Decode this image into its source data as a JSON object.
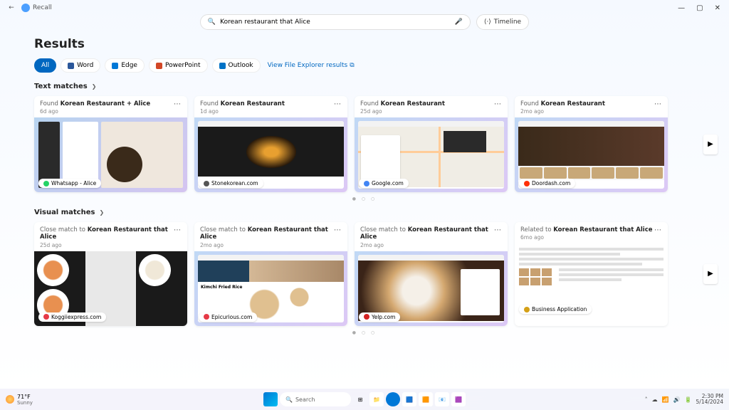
{
  "app": {
    "name": "Recall"
  },
  "search": {
    "value": "Korean restaurant that Alice",
    "timeline_label": "Timeline"
  },
  "page": {
    "title": "Results"
  },
  "filters": {
    "all": "All",
    "items": [
      {
        "label": "Word"
      },
      {
        "label": "Edge"
      },
      {
        "label": "PowerPoint"
      },
      {
        "label": "Outlook"
      }
    ],
    "explorer_link": "View File Explorer results"
  },
  "sections": {
    "text": {
      "title": "Text matches"
    },
    "visual": {
      "title": "Visual matches"
    }
  },
  "text_cards": [
    {
      "prefix": "Found ",
      "title": "Korean Restaurant + Alice",
      "time": "6d ago",
      "source": "Whatsapp - Alice",
      "color": "#25d366"
    },
    {
      "prefix": "Found ",
      "title": "Korean Restaurant",
      "time": "1d ago",
      "source": "Stonekorean.com",
      "color": "#555"
    },
    {
      "prefix": "Found ",
      "title": "Korean Restaurant",
      "time": "25d ago",
      "source": "Google.com",
      "color": "#4285f4"
    },
    {
      "prefix": "Found ",
      "title": "Korean Restaurant",
      "time": "2mo ago",
      "source": "Doordash.com",
      "color": "#ff3008"
    }
  ],
  "visual_cards": [
    {
      "prefix": "Close match to ",
      "title": "Korean Restaurant that Alice",
      "time": "25d ago",
      "source": "Koggiiexpress.com",
      "color": "#e63946"
    },
    {
      "prefix": "Close match to ",
      "title": "Korean Restaurant that Alice",
      "time": "2mo ago",
      "source": "Epicurious.com",
      "color": "#e63946",
      "extra": "Kimchi Fried Rice"
    },
    {
      "prefix": "Close match to ",
      "title": "Korean Restaurant that Alice",
      "time": "2mo ago",
      "source": "Yelp.com",
      "color": "#d32323"
    },
    {
      "prefix": "Related to ",
      "title": "Korean Restaurant that Alice",
      "time": "6mo ago",
      "source": "Business Application",
      "color": "#d4a017"
    }
  ],
  "taskbar": {
    "temp": "71°F",
    "cond": "Sunny",
    "search": "Search",
    "time": "2:30 PM",
    "date": "5/14/2024"
  }
}
